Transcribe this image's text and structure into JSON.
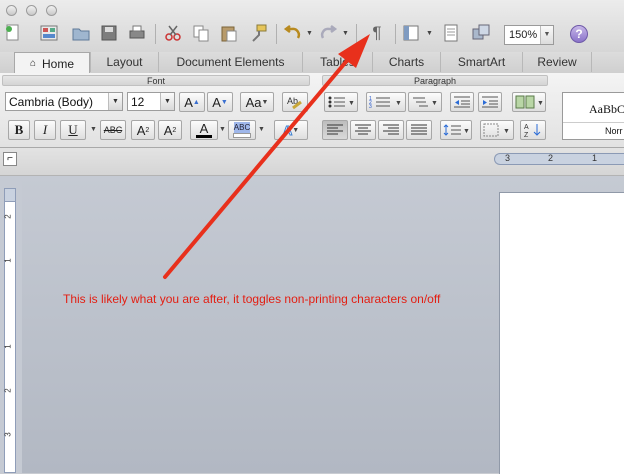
{
  "toolbar": {
    "zoom_value": "150%",
    "help_label": "?",
    "pilcrow": "¶"
  },
  "ribbon_tabs": [
    "Home",
    "Layout",
    "Document Elements",
    "Tables",
    "Charts",
    "SmartArt",
    "Review"
  ],
  "font_group": {
    "label": "Font",
    "font_name": "Cambria (Body)",
    "font_size": "12",
    "bold": "B",
    "italic": "I",
    "underline": "U",
    "strike": "ABC",
    "superscript": "A",
    "subscript": "A",
    "change_case": "Aa",
    "grow": "A",
    "shrink": "A",
    "font_color": "A",
    "highlight": "ABC",
    "text_effects": "A"
  },
  "paragraph_group": {
    "label": "Paragraph"
  },
  "styles_group": {
    "sample": "AaBbCc",
    "name": "Norr"
  },
  "horizontal_ruler": [
    "3",
    "2",
    "1"
  ],
  "vertical_ruler": [
    "2",
    "1",
    "1",
    "2",
    "3"
  ],
  "annotation": {
    "text": "This is likely what you are after, it toggles non-printing characters on/off",
    "color": "#e31e12"
  },
  "colors": {
    "arrow": "#e8301c",
    "accent_purple": "#8a73c9"
  }
}
